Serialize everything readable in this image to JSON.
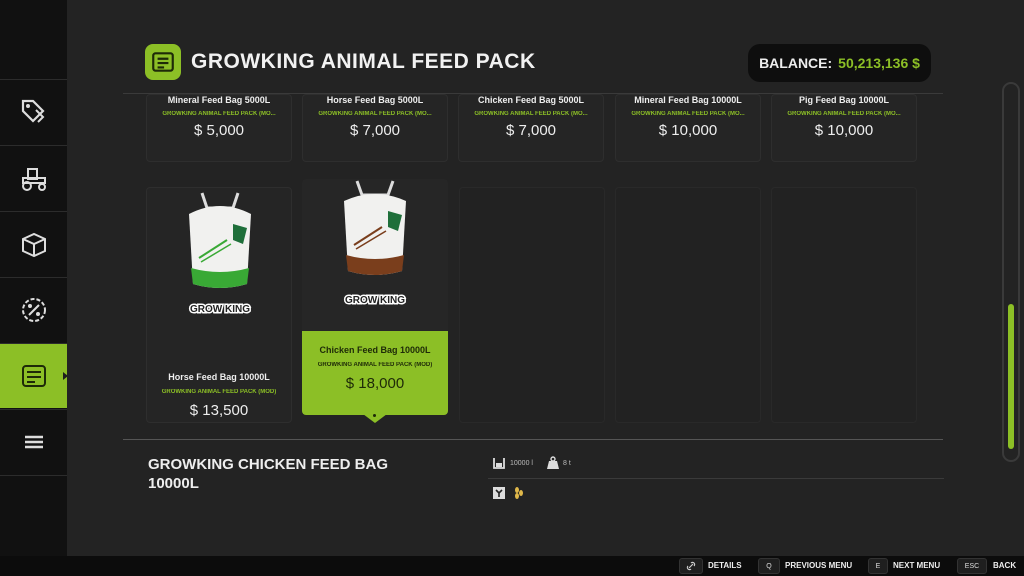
{
  "header": {
    "title": "GROWKING ANIMAL FEED PACK",
    "balance_label": "BALANCE:",
    "balance_value": "50,213,136 $"
  },
  "sidebar": {
    "items": [
      {
        "icon": "price-tags-icon"
      },
      {
        "icon": "tractor-icon"
      },
      {
        "icon": "box-icon"
      },
      {
        "icon": "discount-icon"
      },
      {
        "icon": "shop-list-icon",
        "active": true
      },
      {
        "icon": "menu-icon"
      }
    ]
  },
  "top_row": [
    {
      "name": "Mineral Feed Bag 5000L",
      "mod": "GROWKING ANIMAL FEED PACK (MO...",
      "price": "$ 5,000"
    },
    {
      "name": "Horse Feed Bag 5000L",
      "mod": "GROWKING ANIMAL FEED PACK (MO...",
      "price": "$ 7,000"
    },
    {
      "name": "Chicken Feed Bag 5000L",
      "mod": "GROWKING ANIMAL FEED PACK (MO...",
      "price": "$ 7,000"
    },
    {
      "name": "Mineral Feed Bag 10000L",
      "mod": "GROWKING ANIMAL FEED PACK (MO...",
      "price": "$ 10,000"
    },
    {
      "name": "Pig Feed Bag 10000L",
      "mod": "GROWKING ANIMAL FEED PACK (MO...",
      "price": "$ 10,000"
    }
  ],
  "items": [
    {
      "name": "Horse Feed Bag 10000L",
      "mod": "GROWKING ANIMAL FEED PACK (MOD)",
      "price": "$ 13,500",
      "logo": "GROW KING",
      "stripe": "#39a935"
    },
    {
      "name": "Chicken Feed Bag 10000L",
      "mod": "GROWKING ANIMAL FEED PACK (MOD)",
      "price": "$ 18,000",
      "logo": "GROW KING",
      "stripe": "#7a3e1c"
    }
  ],
  "detail": {
    "title": "GROWKING CHICKEN FEED BAG 10000L",
    "capacity": "10000 l",
    "weight": "8 t"
  },
  "footer": {
    "details_label": "DETAILS",
    "prev_key": "Q",
    "prev_label": "PREVIOUS MENU",
    "next_key": "E",
    "next_label": "NEXT MENU",
    "back_key": "ESC",
    "back_label": "BACK"
  },
  "colors": {
    "accent": "#8cbf26",
    "background": "#232323"
  }
}
